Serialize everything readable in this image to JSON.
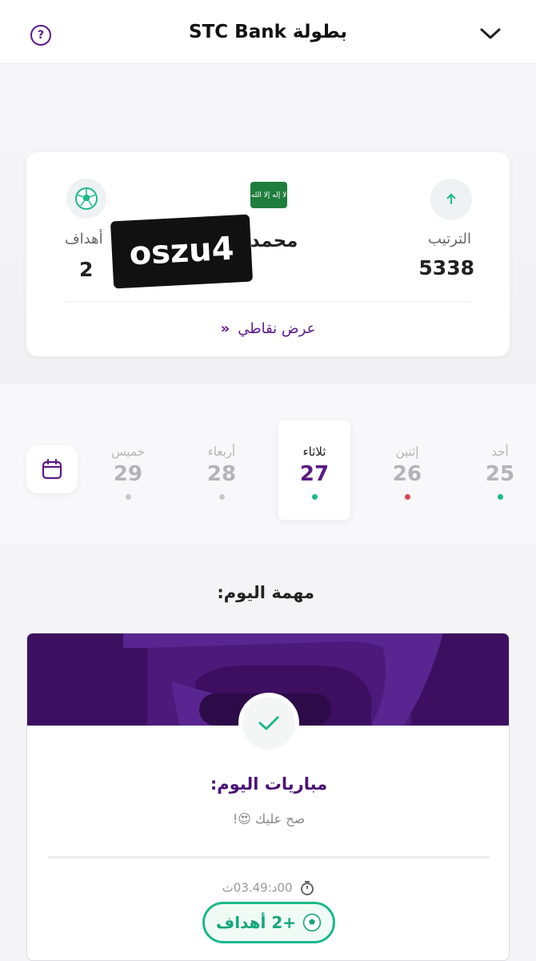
{
  "header": {
    "title": "بطولة STC Bank",
    "help_icon": "?"
  },
  "profile": {
    "rank_label": "الترتيب",
    "rank_value": "5338",
    "player_name": "محمد م",
    "goals_label": "أهداف",
    "goals_value": "2",
    "redacted_overlay": "oszu4",
    "flag_text": "لا إله إلا الله",
    "points_link": "عرض نقاطي",
    "points_link_icon": "»"
  },
  "calendar": {
    "days": [
      {
        "name": "أحد",
        "num": "25",
        "dot_color": "#1bb98a"
      },
      {
        "name": "إثنين",
        "num": "26",
        "dot_color": "#e0464b"
      },
      {
        "name": "ثلاثاء",
        "num": "27",
        "dot_color": "#1bb98a"
      },
      {
        "name": "أربعاء",
        "num": "28",
        "dot_color": "#c8c8cc"
      },
      {
        "name": "خميس",
        "num": "29",
        "dot_color": "#c8c8cc"
      }
    ]
  },
  "task": {
    "section_title": "مهمة اليوم:",
    "title": "مباريات اليوم:",
    "subtitle": "صح عليك 😍!",
    "timer": "00د:03.49ث",
    "reward": "+2 أهداف"
  },
  "colors": {
    "brand_purple": "#5b1a86",
    "accent_green": "#1bb98a",
    "banner_purple": "#3d0f61"
  }
}
